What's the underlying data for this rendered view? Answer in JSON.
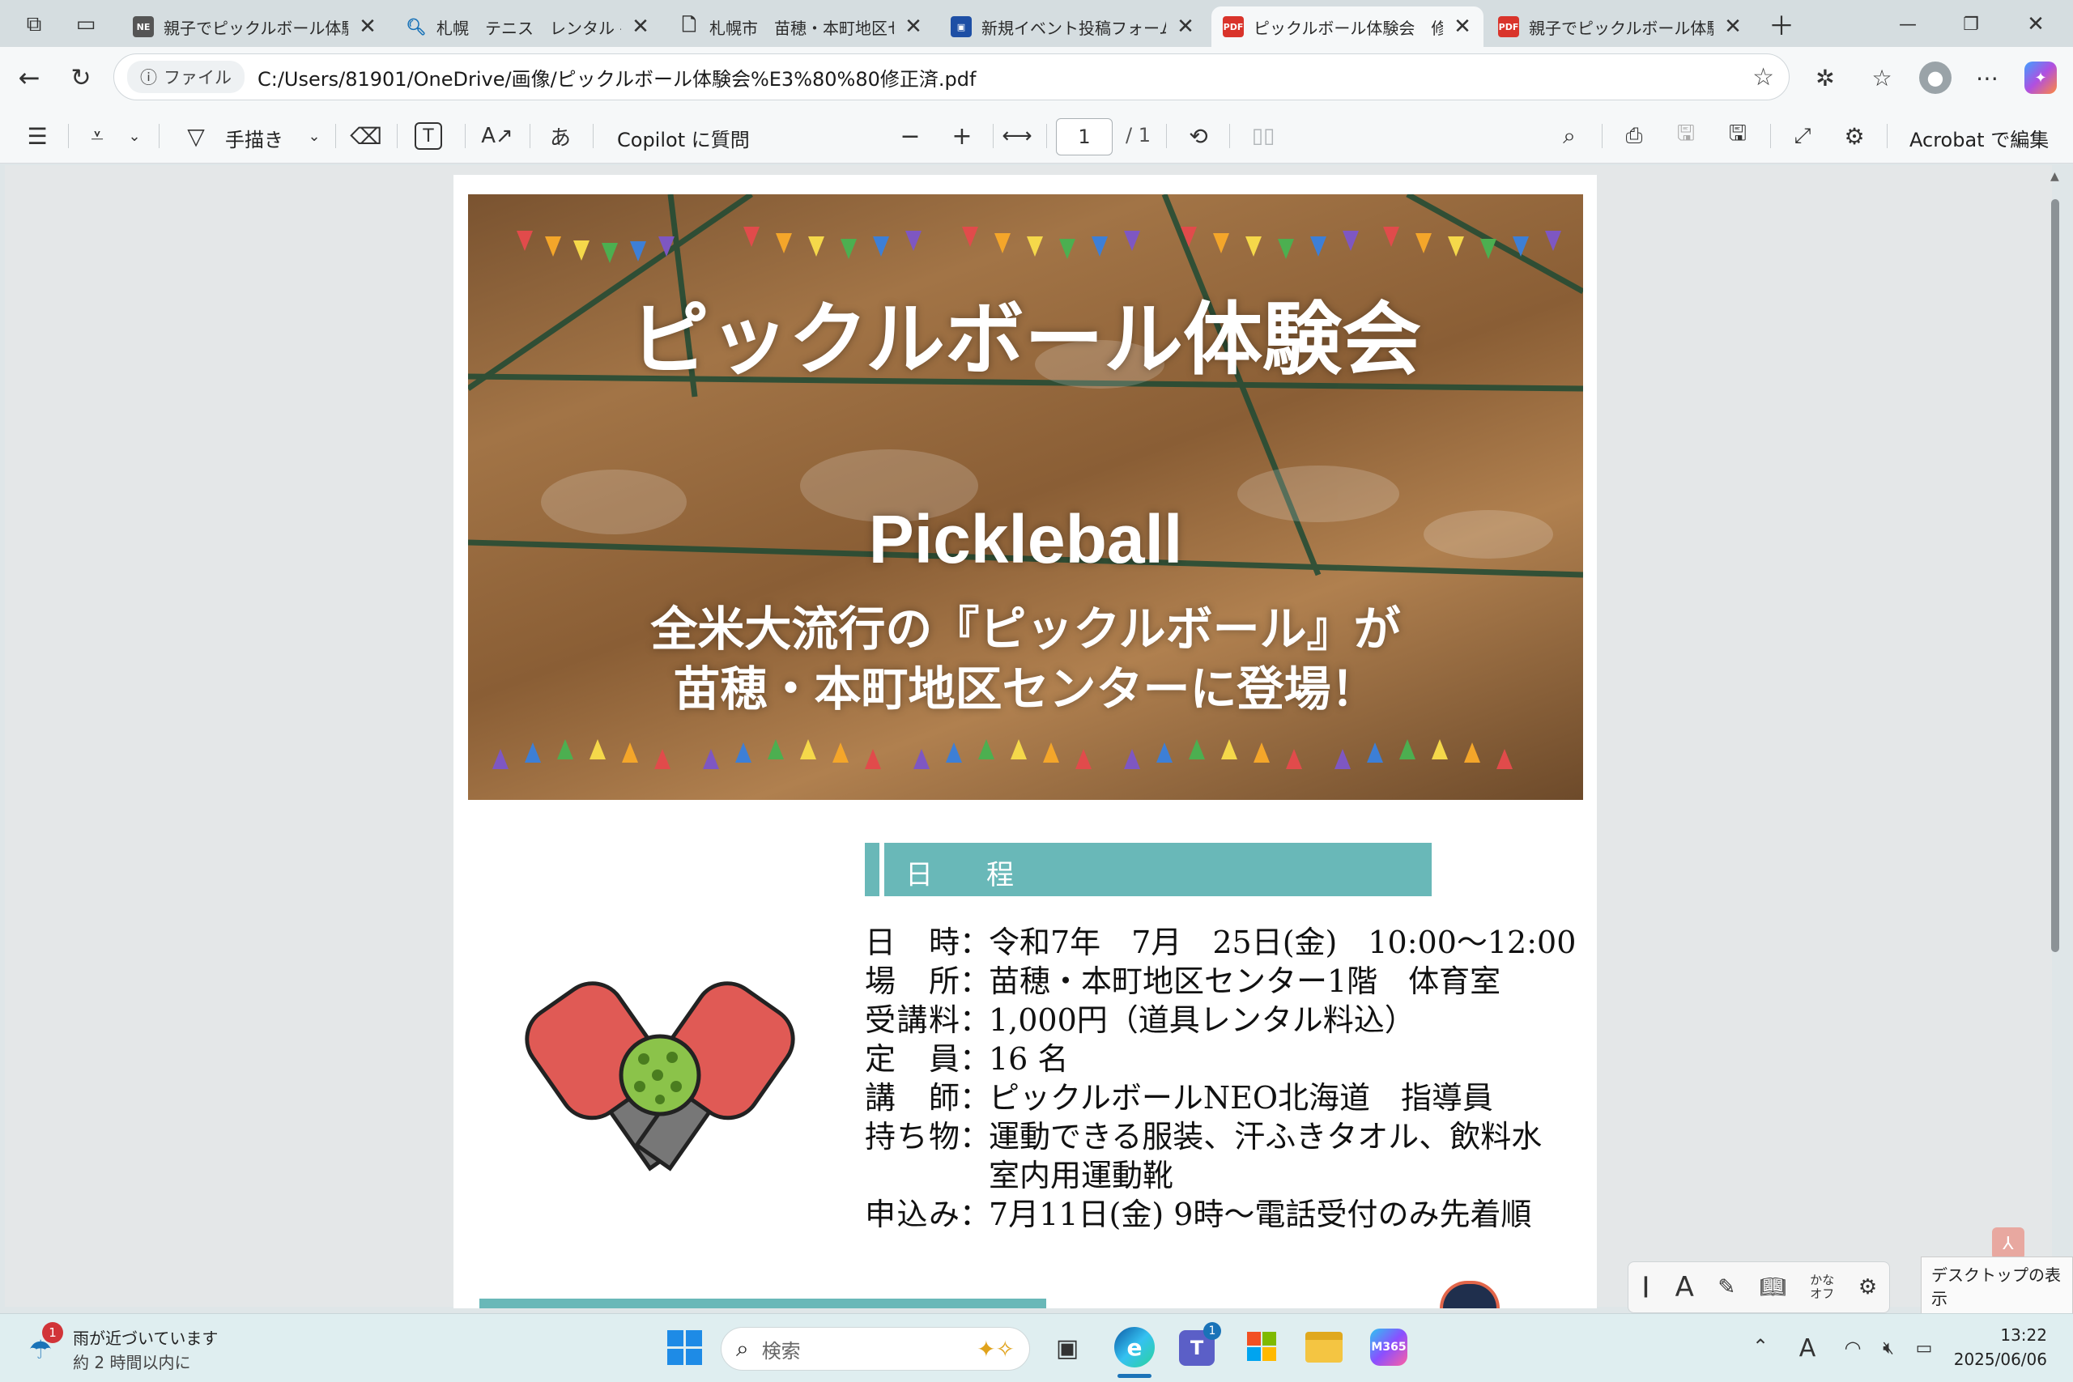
{
  "browser": {
    "tabs": [
      {
        "title": "親子でピックルボール体験",
        "favicon": "pickleball-site-icon"
      },
      {
        "title": "札幌　テニス　レンタル - 検索",
        "favicon": "search-icon"
      },
      {
        "title": "札幌市　苗穂・本町地区センター",
        "favicon": "document-icon"
      },
      {
        "title": "新規イベント投稿フォーム｜",
        "favicon": "form-site-icon"
      },
      {
        "title": "ピックルボール体験会　修正済",
        "favicon": "pdf-icon"
      },
      {
        "title": "親子でピックルボール体験会",
        "favicon": "pdf-icon"
      }
    ],
    "address": {
      "badge": "ファイル",
      "url": "C:/Users/81901/OneDrive/画像/ピックルボール体験会%E3%80%80修正済.pdf"
    }
  },
  "pdf_toolbar": {
    "draw": "手描き",
    "copilot": "Copilot に質問",
    "page_current": "1",
    "page_total": "/ 1",
    "acrobat": "Acrobat で編集"
  },
  "flyer": {
    "title": "ピックルボール体験会",
    "subtitle": "Pickleball",
    "tagline1": "全米大流行の『ピックルボール』が",
    "tagline2": "苗穂・本町地区センターに登場！",
    "schedule_heading": "日　程",
    "details": [
      {
        "key": "日　時",
        "value": "令和7年　7月　25日(金)　10:00〜12:00"
      },
      {
        "key": "場　所",
        "value": "苗穂・本町地区センター1階　体育室"
      },
      {
        "key": "受講料",
        "value": "1,000円（道具レンタル料込）"
      },
      {
        "key": "定　員",
        "value": "16 名"
      },
      {
        "key": "講　師",
        "value": "ピックルボールNEO北海道　指導員"
      },
      {
        "key": "持ち物",
        "value": "運動できる服装、汗ふきタオル、飲料水"
      },
      {
        "key": "",
        "value": "室内用運動靴"
      },
      {
        "key": "申込み",
        "value": "7月11日(金) 9時〜電話受付のみ先着順"
      }
    ]
  },
  "tooltip": "デスクトップの表示",
  "ime": {
    "kana": "かな",
    "off": "オフ"
  },
  "weather": {
    "badge": "1",
    "line1": "雨が近づいています",
    "line2": "約 2 時間以内に"
  },
  "taskbar": {
    "search": "検索",
    "teams_badge": "1",
    "m365": "M365"
  },
  "clock": {
    "time": "13:22",
    "date": "2025/06/06"
  },
  "colors": {
    "teal": "#69b8b8",
    "paddle": "#e05a55",
    "ball": "#8bc34a"
  }
}
